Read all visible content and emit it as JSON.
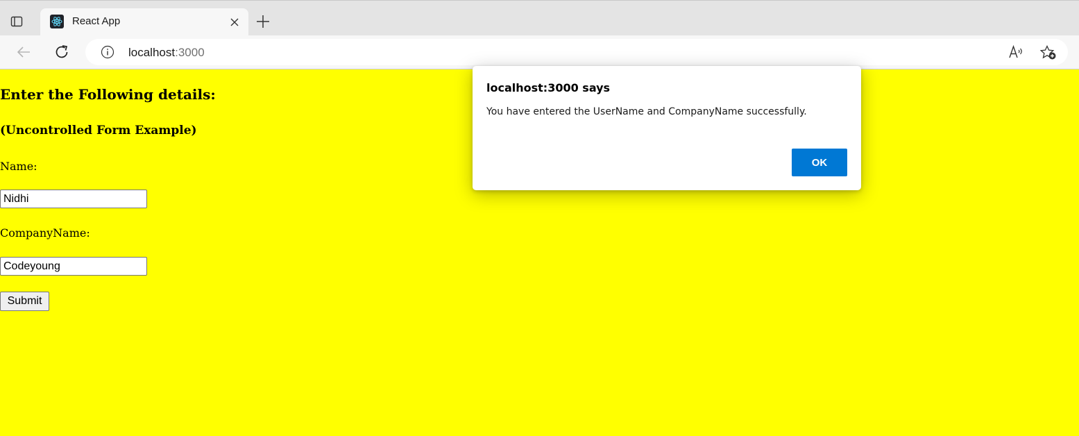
{
  "browser": {
    "tab": {
      "title": "React App",
      "favicon": "react-logo-icon"
    },
    "address": {
      "host": "localhost",
      "port": ":3000"
    },
    "icons": {
      "tab_actions": "tab-actions-icon",
      "close": "close-icon",
      "new_tab": "plus-icon",
      "back": "back-arrow-icon",
      "reload": "reload-icon",
      "site_info": "info-icon",
      "read_aloud": "read-aloud-icon",
      "favorites": "add-favorite-icon"
    }
  },
  "page": {
    "background": "#ffff00",
    "heading": "Enter the Following details:",
    "subheading": "(Uncontrolled Form Example)",
    "form": {
      "name_label": "Name:",
      "name_value": "Nidhi",
      "company_label": "CompanyName:",
      "company_value": "Codeyoung",
      "submit_label": "Submit"
    }
  },
  "alert": {
    "title": "localhost:3000 says",
    "message": "You have entered the UserName and CompanyName successfully.",
    "ok_label": "OK",
    "ok_color": "#0078d4"
  }
}
